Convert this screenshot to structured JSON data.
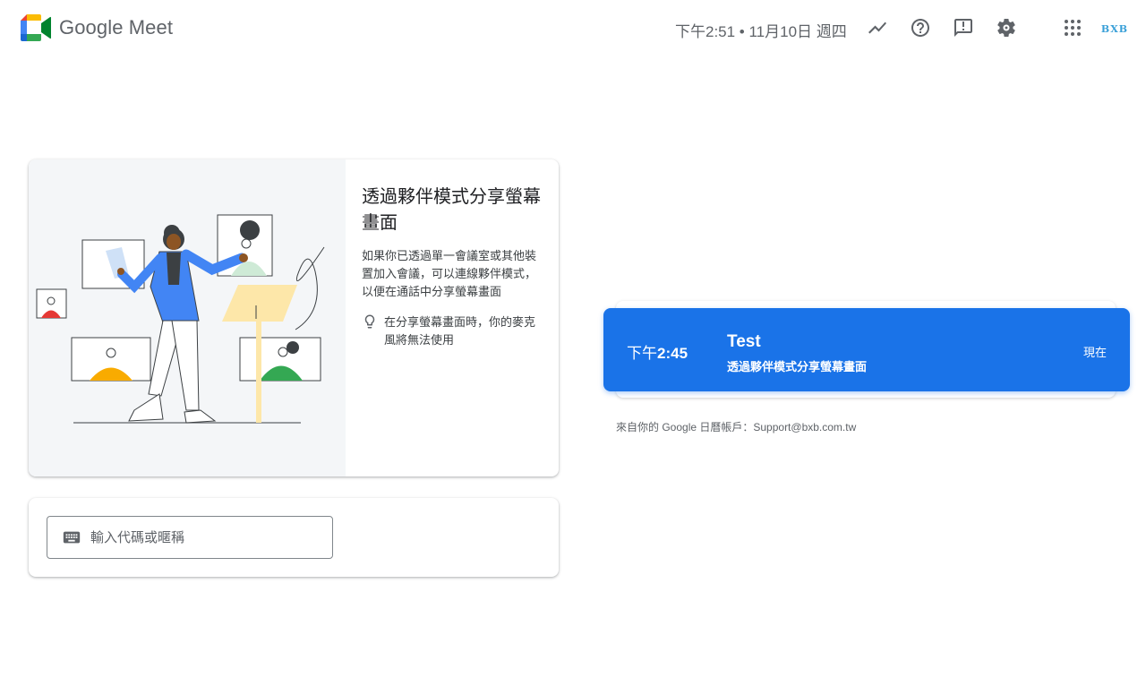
{
  "app": {
    "name": "Google Meet"
  },
  "header": {
    "datetime": "下午2:51 • 11月10日 週四",
    "icons": [
      "quality-trend-icon",
      "help-icon",
      "feedback-icon",
      "settings-icon",
      "apps-icon"
    ],
    "account_badge": "BXB"
  },
  "promo": {
    "title": "透過夥伴模式分享螢幕畫面",
    "description": "如果你已透過單一會議室或其他裝置加入會議，可以連線夥伴模式，以便在通話中分享螢幕畫面",
    "tip": "在分享螢幕畫面時，你的麥克風將無法使用"
  },
  "join": {
    "placeholder": "輸入代碼或暱稱",
    "value": ""
  },
  "meeting": {
    "time_prefix": "下午",
    "time_value": "2:45",
    "title": "Test",
    "subtitle": "透過夥伴模式分享螢幕畫面",
    "status": "現在"
  },
  "calendar_note": "來自你的 Google 日曆帳戶：Support@bxb.com.tw",
  "colors": {
    "accent": "#1a73e8",
    "text_secondary": "#5f6368"
  }
}
